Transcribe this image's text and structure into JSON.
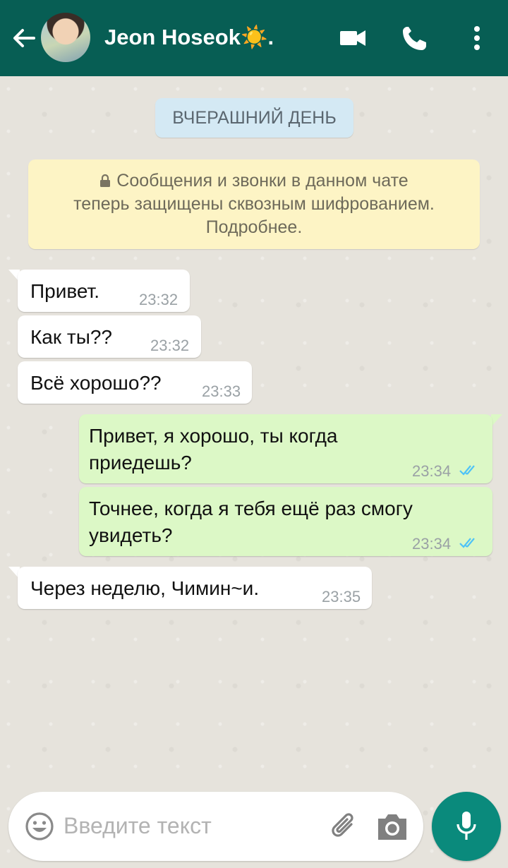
{
  "header": {
    "contact_name": "Jeon Hoseok☀️.",
    "bg_color": "#075e54",
    "icons": [
      "back-arrow-icon",
      "video-call-icon",
      "phone-call-icon",
      "more-options-icon"
    ]
  },
  "date_chip": "ВЧЕРАШНИЙ ДЕНЬ",
  "notice": {
    "line1": "Сообщения и звонки в данном чате",
    "line2": "теперь защищены сквозным шифрованием.",
    "line3": "Подробнее."
  },
  "messages": [
    {
      "dir": "in",
      "text": "Привет.",
      "time": "23:32"
    },
    {
      "dir": "in",
      "text": "Как ты??",
      "time": "23:32"
    },
    {
      "dir": "in",
      "text": "Всё хорошо??",
      "time": "23:33"
    },
    {
      "dir": "out",
      "line1": "Привет, я хорошо, ты когда",
      "line2": "приедешь?",
      "time": "23:34",
      "status": "read"
    },
    {
      "dir": "out",
      "line1": "Точнее, когда я тебя ещё раз смогу",
      "line2": "увидеть?",
      "time": "23:34",
      "status": "read"
    },
    {
      "dir": "in",
      "text": "Через неделю, Чимин~и.",
      "time": "23:35"
    }
  ],
  "composer": {
    "placeholder": "Введите текст",
    "icons": [
      "emoji-icon",
      "attach-icon",
      "camera-icon",
      "mic-icon"
    ]
  },
  "colors": {
    "incoming_bubble": "#ffffff",
    "outgoing_bubble": "#dcf8c6",
    "read_ticks": "#4fc3f7",
    "mic_button": "#0a8a7c"
  }
}
